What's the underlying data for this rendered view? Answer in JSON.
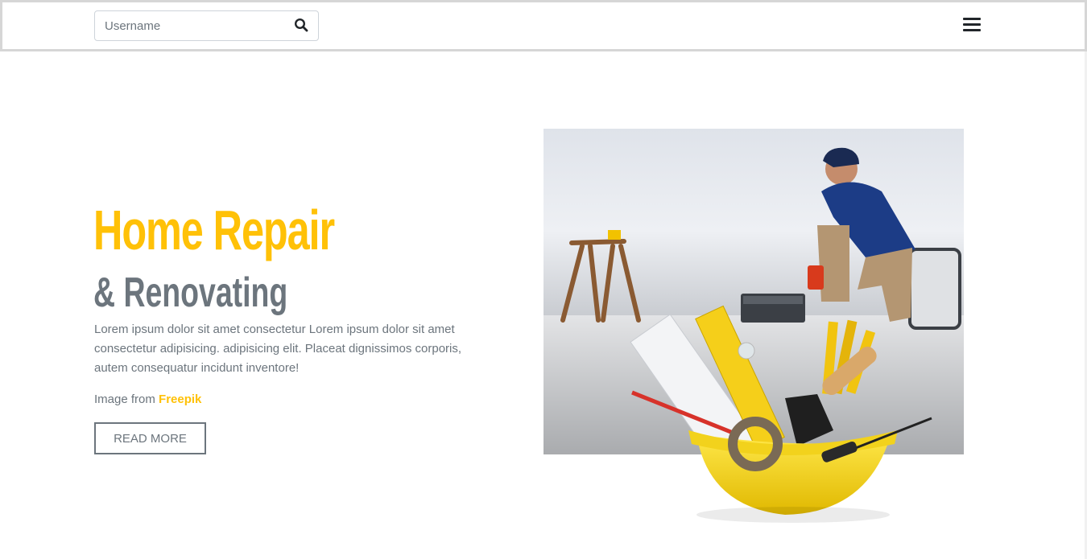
{
  "header": {
    "search": {
      "placeholder": "Username",
      "value": "",
      "icon": "search-icon"
    },
    "menu": {
      "icon": "hamburger-menu-icon"
    }
  },
  "hero": {
    "title": "Home Repair",
    "subtitle": "& Renovating",
    "description": "Lorem ipsum dolor sit amet consectetur Lorem ipsum dolor sit amet consectetur adipisicing. adipisicing elit. Placeat dignissimos corporis, autem consequatur incidunt inventore!",
    "credit_prefix": "Image from",
    "credit_link": "Freepik",
    "button_label": "READ MORE"
  },
  "colors": {
    "accent": "#ffc107",
    "text_muted": "#6c757d",
    "dark": "#212529"
  }
}
